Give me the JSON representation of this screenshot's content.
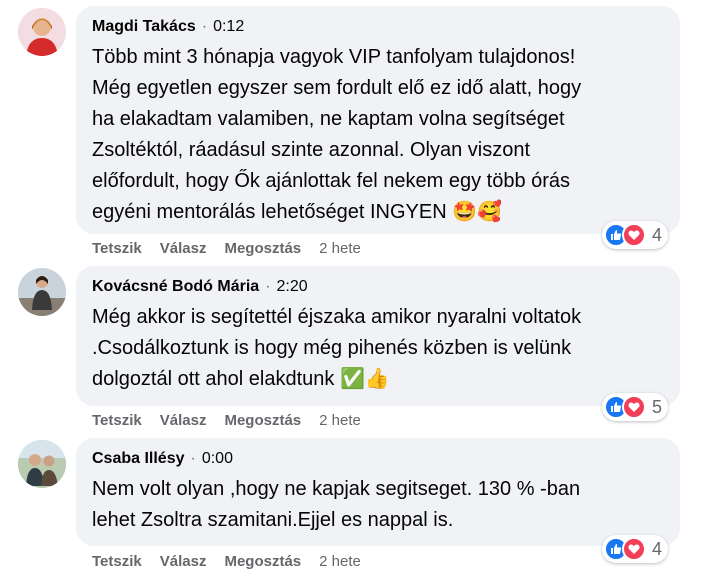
{
  "actions": {
    "like_label": "Tetszik",
    "reply_label": "Válasz",
    "share_label": "Megosztás"
  },
  "comments": [
    {
      "author": "Magdi Takács",
      "time": "0:12",
      "text": "Több mint 3 hónapja vagyok VIP tanfolyam tulajdonos!\nMég egyetlen egyszer sem fordult elő ez idő alatt, hogy\nha elakadtam valamiben, ne kaptam volna segítséget\nZsoltéktól, ráadásul szinte azonnal. Olyan viszont\nelőfordult, hogy Ők ajánlottak fel nekem egy több órás\negyéni mentorálás lehetőséget INGYEN",
      "emojis": "🤩🥰",
      "age": "2 hete",
      "reaction_count": "4"
    },
    {
      "author": "Kovácsné Bodó Mária",
      "time": "2:20",
      "text": "Még akkor is segítettél éjszaka amikor nyaralni voltatok\n.Csodálkoztunk is hogy még pihenés közben is velünk\ndolgoztál ott ahol elakdtunk",
      "emojis": "✅👍",
      "age": "2 hete",
      "reaction_count": "5"
    },
    {
      "author": "Csaba Illésy",
      "time": "0:00",
      "text": "Nem volt olyan ,hogy ne kapjak segitseget. 130 % -ban\nlehet Zsoltra szamitani.Ejjel es nappal is.",
      "emojis": "",
      "age": "2 hete",
      "reaction_count": "4"
    }
  ],
  "colors": {
    "bubble": "#f0f2f5",
    "like": "#1877f2",
    "love": "#f33e58",
    "meta": "#65676b"
  }
}
